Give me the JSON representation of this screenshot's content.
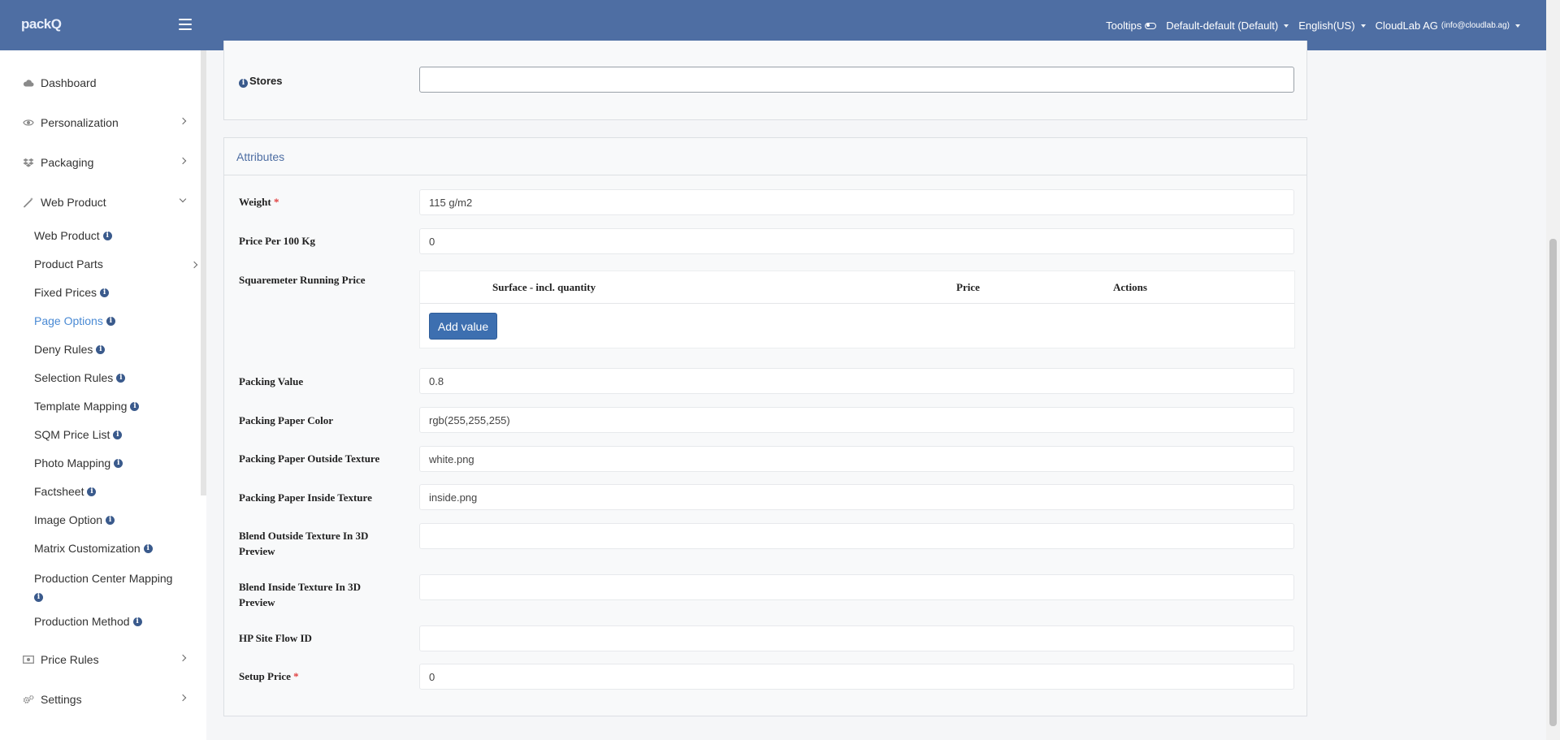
{
  "app": {
    "logo": "packQ"
  },
  "topbar": {
    "tooltips_label": "Tooltips",
    "store_selector": "Default-default (Default)",
    "language_selector": "English(US)",
    "account_name": "CloudLab AG",
    "account_email": "(info@cloudlab.ag)"
  },
  "sidebar": {
    "items": [
      {
        "label": "Dashboard",
        "icon": "cloud-icon"
      },
      {
        "label": "Personalization",
        "icon": "eye-icon"
      },
      {
        "label": "Packaging",
        "icon": "dropbox-icon"
      },
      {
        "label": "Web Product",
        "icon": "magic-wand-icon"
      },
      {
        "label": "Price Rules",
        "icon": "money-icon"
      },
      {
        "label": "Settings",
        "icon": "cogs-icon"
      }
    ],
    "subitems": [
      {
        "label": "Web Product"
      },
      {
        "label": "Product Parts"
      },
      {
        "label": "Fixed Prices"
      },
      {
        "label": "Page Options"
      },
      {
        "label": "Deny Rules"
      },
      {
        "label": "Selection Rules"
      },
      {
        "label": "Template Mapping"
      },
      {
        "label": "SQM Price List"
      },
      {
        "label": "Photo Mapping"
      },
      {
        "label": "Factsheet"
      },
      {
        "label": "Image Option"
      },
      {
        "label": "Matrix Customization"
      },
      {
        "label": "Production Center Mapping"
      },
      {
        "label": "Production Method"
      }
    ]
  },
  "stores": {
    "label": "Stores",
    "value": ""
  },
  "attributes": {
    "title": "Attributes",
    "weight": {
      "label": "Weight",
      "value": "115 g/m2"
    },
    "price_per_100kg": {
      "label": "Price Per 100 Kg",
      "value": "0"
    },
    "sqm_running_price": {
      "label": "Squaremeter Running Price",
      "columns": [
        "Surface - incl. quantity",
        "Price",
        "Actions"
      ],
      "add_button": "Add value"
    },
    "packing_value": {
      "label": "Packing Value",
      "value": "0.8"
    },
    "packing_paper_color": {
      "label": "Packing Paper Color",
      "value": "rgb(255,255,255)"
    },
    "outside_texture": {
      "label": "Packing Paper Outside Texture",
      "value": "white.png"
    },
    "inside_texture": {
      "label": "Packing Paper Inside Texture",
      "value": "inside.png"
    },
    "blend_outside": {
      "label": "Blend Outside Texture In 3D Preview",
      "value": ""
    },
    "blend_inside": {
      "label": "Blend Inside Texture In 3D Preview",
      "value": ""
    },
    "hp_site_flow": {
      "label": "HP Site Flow ID",
      "value": ""
    },
    "setup_price": {
      "label": "Setup Price",
      "value": "0"
    }
  }
}
